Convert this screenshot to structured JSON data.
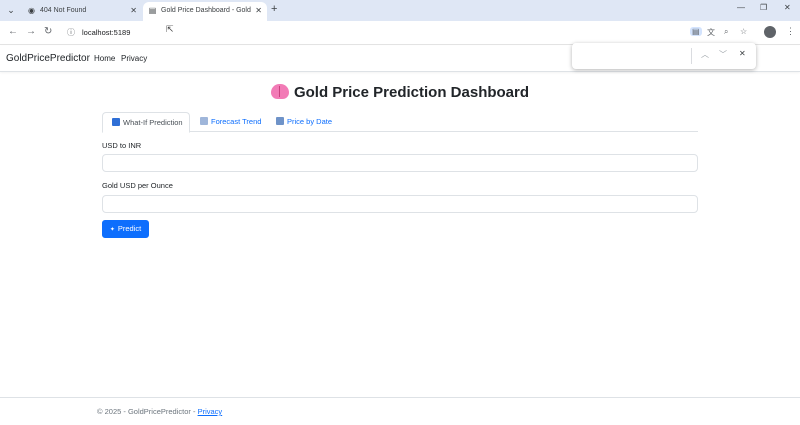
{
  "browser": {
    "tabs": [
      {
        "title": "404 Not Found",
        "active": false
      },
      {
        "title": "Gold Price Dashboard - GoldPr",
        "active": true
      }
    ],
    "url": "localhost:5189"
  },
  "site": {
    "brand": "GoldPricePredictor",
    "nav": [
      "Home",
      "Privacy"
    ]
  },
  "main": {
    "title": "Gold Price Prediction Dashboard",
    "tabs": [
      {
        "label": "What-If Prediction",
        "active": true,
        "icon_color": "#2f6fd6"
      },
      {
        "label": "Forecast Trend",
        "active": false,
        "icon_color": "#6f93c8"
      },
      {
        "label": "Price by Date",
        "active": false,
        "icon_color": "#6f93c8"
      }
    ],
    "fields": [
      {
        "label": "USD to INR",
        "value": ""
      },
      {
        "label": "Gold USD per Ounce",
        "value": ""
      }
    ],
    "predict_label": "Predict"
  },
  "footer": {
    "text": "© 2025 - GoldPricePredictor - ",
    "link": "Privacy"
  },
  "colors": {
    "primary": "#0d6efd",
    "tabstrip": "#dfe7f5",
    "brain": "#f27bb6"
  },
  "icons": {
    "tab_menu": "chevron-down-icon",
    "tab1_fav": "globe-icon",
    "tab2_fav": "page-icon",
    "page_heading": "brain-icon"
  }
}
